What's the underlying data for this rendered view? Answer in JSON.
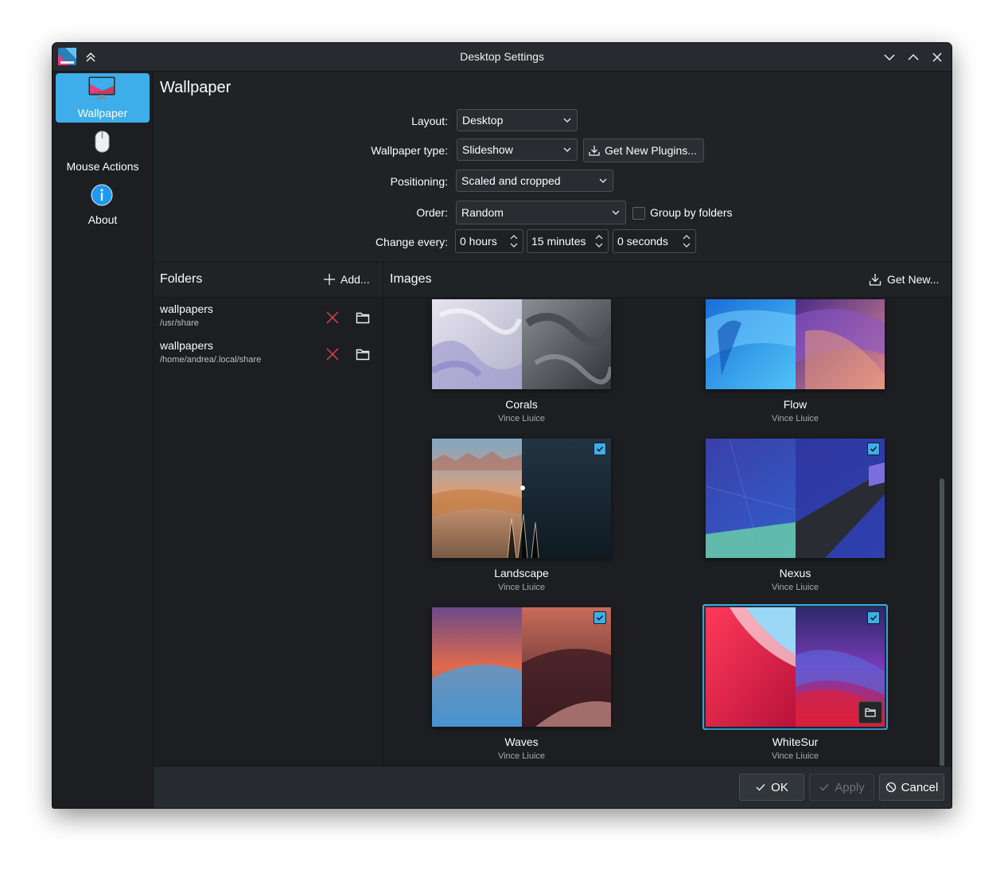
{
  "window": {
    "title": "Desktop Settings"
  },
  "sidebar": {
    "items": [
      {
        "label": "Wallpaper",
        "icon": "monitor-icon",
        "active": true
      },
      {
        "label": "Mouse Actions",
        "icon": "mouse-icon",
        "active": false
      },
      {
        "label": "About",
        "icon": "info-icon",
        "active": false
      }
    ]
  },
  "page": {
    "title": "Wallpaper"
  },
  "form": {
    "layout_label": "Layout:",
    "layout_value": "Desktop",
    "type_label": "Wallpaper type:",
    "type_value": "Slideshow",
    "get_plugins": "Get New Plugins...",
    "positioning_label": "Positioning:",
    "positioning_value": "Scaled and cropped",
    "order_label": "Order:",
    "order_value": "Random",
    "group_label": "Group by folders",
    "group_checked": false,
    "change_label": "Change every:",
    "hours": "0 hours",
    "minutes": "15 minutes",
    "seconds": "0 seconds"
  },
  "folders": {
    "title": "Folders",
    "add": "Add...",
    "items": [
      {
        "name": "wallpapers",
        "path": "/usr/share"
      },
      {
        "name": "wallpapers",
        "path": "/home/andrea/.local/share"
      }
    ]
  },
  "images": {
    "title": "Images",
    "get_new": "Get New...",
    "items": [
      {
        "name": "Corals",
        "author": "Vince Liuice",
        "checked": false,
        "selected": false
      },
      {
        "name": "Flow",
        "author": "Vince Liuice",
        "checked": false,
        "selected": false
      },
      {
        "name": "Landscape",
        "author": "Vince Liuice",
        "checked": true,
        "selected": false
      },
      {
        "name": "Nexus",
        "author": "Vince Liuice",
        "checked": true,
        "selected": false
      },
      {
        "name": "Waves",
        "author": "Vince Liuice",
        "checked": true,
        "selected": false
      },
      {
        "name": "WhiteSur",
        "author": "Vince Liuice",
        "checked": true,
        "selected": true
      }
    ]
  },
  "footer": {
    "ok": "OK",
    "apply": "Apply",
    "cancel": "Cancel"
  },
  "colors": {
    "accent": "#3daee9",
    "remove": "#da4453",
    "window_bg": "#202326"
  }
}
